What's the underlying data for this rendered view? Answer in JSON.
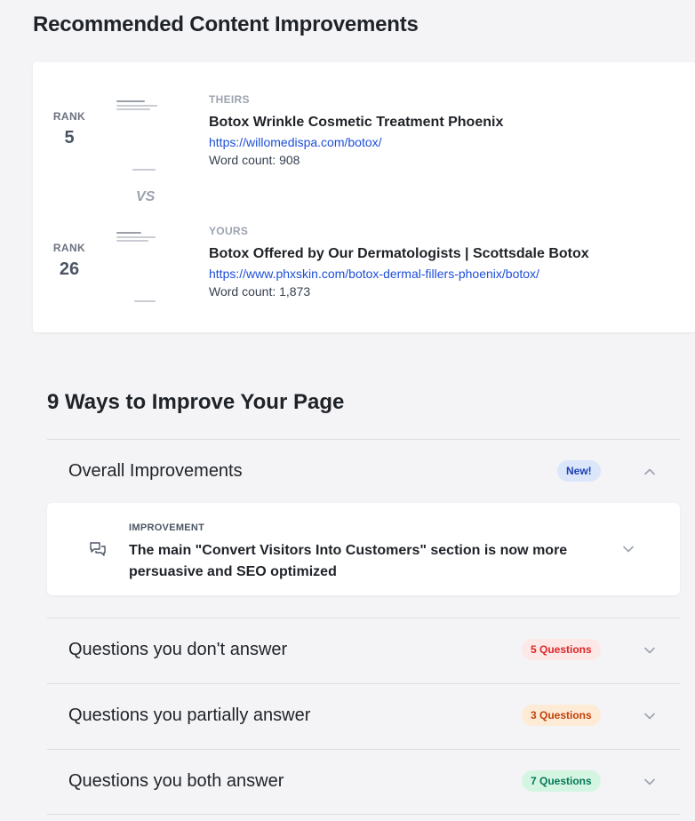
{
  "page_title": "Recommended Content Improvements",
  "comparison": {
    "vs_label": "VS",
    "theirs": {
      "rank_label": "RANK",
      "rank": "5",
      "kind": "THEIRS",
      "title": "Botox Wrinkle Cosmetic Treatment Phoenix",
      "url": "https://willomedispa.com/botox/",
      "word_count": "Word count: 908"
    },
    "yours": {
      "rank_label": "RANK",
      "rank": "26",
      "kind": "YOURS",
      "title": "Botox Offered by Our Dermatologists | Scottsdale Botox",
      "url": "https://www.phxskin.com/botox-dermal-fillers-phoenix/botox/",
      "word_count": "Word count: 1,873"
    }
  },
  "ways_title": "9 Ways to Improve Your Page",
  "sections": [
    {
      "label": "Overall Improvements",
      "badge": "New!",
      "badge_color": "#1e40af",
      "badge_bg": "#dbe6fb",
      "expanded": true
    },
    {
      "label": "Questions you don't answer",
      "badge": "5 Questions",
      "badge_color": "#dc2626",
      "badge_bg": "#fde8e8",
      "expanded": false
    },
    {
      "label": "Questions you partially answer",
      "badge": "3 Questions",
      "badge_color": "#c2410c",
      "badge_bg": "#fdebd6",
      "expanded": false
    },
    {
      "label": "Questions you both answer",
      "badge": "7 Questions",
      "badge_color": "#047857",
      "badge_bg": "#d5f5e3",
      "expanded": false
    }
  ],
  "improvement": {
    "kind": "IMPROVEMENT",
    "text": "The main \"Convert Visitors Into Customers\" section is now more persuasive and SEO optimized",
    "icon": "chat-bubbles-icon"
  }
}
